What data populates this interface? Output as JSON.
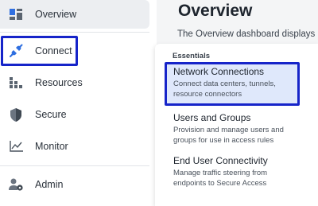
{
  "sidebar": {
    "items": [
      {
        "label": "Overview",
        "icon": "dashboard-icon"
      },
      {
        "label": "Connect",
        "icon": "plug-icon"
      },
      {
        "label": "Resources",
        "icon": "resources-icon"
      },
      {
        "label": "Secure",
        "icon": "shield-icon"
      },
      {
        "label": "Monitor",
        "icon": "line-chart-icon"
      },
      {
        "label": "Admin",
        "icon": "user-settings-icon"
      }
    ]
  },
  "main": {
    "title": "Overview",
    "description": "The Overview dashboard displays"
  },
  "dropdown": {
    "section": "Essentials",
    "items": [
      {
        "title": "Network Connections",
        "description": "Connect data centers, tunnels, resource connectors"
      },
      {
        "title": "Users and Groups",
        "description": "Provision and manage users and groups for use in access rules"
      },
      {
        "title": "End User Connectivity",
        "description": "Manage traffic steering from endpoints to Secure Access"
      }
    ]
  },
  "colors": {
    "highlight": "#1624c9",
    "active_bg": "#dfe8fb",
    "icon_blue": "#2f6fe0"
  }
}
